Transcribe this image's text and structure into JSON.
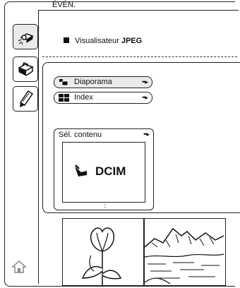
{
  "header": {
    "title": "ÉVÉN."
  },
  "sidebar": {
    "tabs": [
      {
        "name": "viewer-tab",
        "icon": "camera-projector-icon",
        "active": true
      },
      {
        "name": "toolbox-tab",
        "icon": "toolbox-icon",
        "active": false
      },
      {
        "name": "pencil-tab",
        "icon": "pencil-icon",
        "active": false
      }
    ],
    "home_icon": "home-icon"
  },
  "main": {
    "heading_prefix": "Visualisateur ",
    "heading_bold": "JPEG",
    "menu": [
      {
        "label": "Diaporama",
        "icon": "slideshow-icon",
        "arrow": "••▸",
        "selected": true
      },
      {
        "label": "Index",
        "icon": "index-grid-icon",
        "arrow": "••▸",
        "selected": false
      }
    ],
    "content_select": {
      "label": "Sél. contenu",
      "arrow": "••▸",
      "folder_label": "DCIM",
      "folder_icon": "folder-arrow-icon"
    },
    "more_indicator": "⋮",
    "thumbnails": [
      {
        "subject": "tulip-drawing"
      },
      {
        "subject": "mountain-lake-drawing"
      }
    ]
  }
}
